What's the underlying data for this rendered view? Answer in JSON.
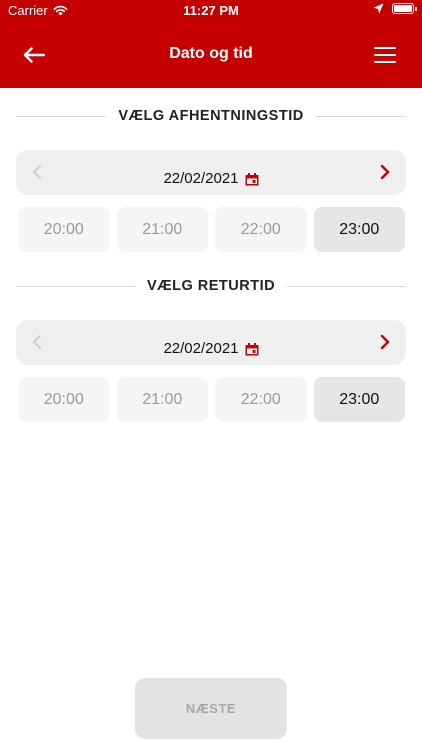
{
  "status_bar": {
    "carrier": "Carrier",
    "time": "11:27 PM"
  },
  "header": {
    "title": "Dato og tid",
    "back_icon": "arrow-left-icon",
    "menu_icon": "hamburger-menu-icon",
    "background_color": "#c40000"
  },
  "pickup": {
    "heading": "VÆLG AFHENTNINGSTID",
    "date": "22/02/2021",
    "slots": [
      {
        "label": "20:00",
        "selected": false
      },
      {
        "label": "21:00",
        "selected": false
      },
      {
        "label": "22:00",
        "selected": false
      },
      {
        "label": "23:00",
        "selected": true
      }
    ]
  },
  "return": {
    "heading": "VÆLG RETURTID",
    "date": "22/02/2021",
    "slots": [
      {
        "label": "20:00",
        "selected": false
      },
      {
        "label": "21:00",
        "selected": false
      },
      {
        "label": "22:00",
        "selected": false
      },
      {
        "label": "23:00",
        "selected": true
      }
    ]
  },
  "next_button": {
    "label": "NÆSTE",
    "enabled": false
  },
  "colors": {
    "accent": "#c40000",
    "disabled_arrow": "#c8c8c8"
  }
}
